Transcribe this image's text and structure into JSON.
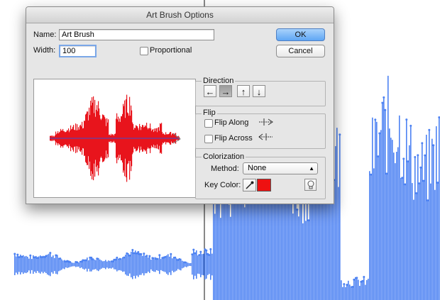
{
  "dialog": {
    "title": "Art Brush Options",
    "name_label": "Name:",
    "name_value": "Art Brush",
    "width_label": "Width:",
    "width_value": "100",
    "proportional_label": "Proportional",
    "ok_label": "OK",
    "cancel_label": "Cancel",
    "direction": {
      "title": "Direction",
      "buttons": [
        "←",
        "→",
        "↑",
        "↓"
      ],
      "selected": "→"
    },
    "flip": {
      "title": "Flip",
      "flip_along_label": "Flip Along",
      "flip_across_label": "Flip Across"
    },
    "colorization": {
      "title": "Colorization",
      "method_label": "Method:",
      "method_value": "None",
      "key_color_label": "Key Color:",
      "key_color": "#ee1111"
    },
    "preview_color": "#e8141c"
  },
  "background": {
    "waveform_color": "#4d82f2",
    "cursor_line_color": "#111111"
  }
}
